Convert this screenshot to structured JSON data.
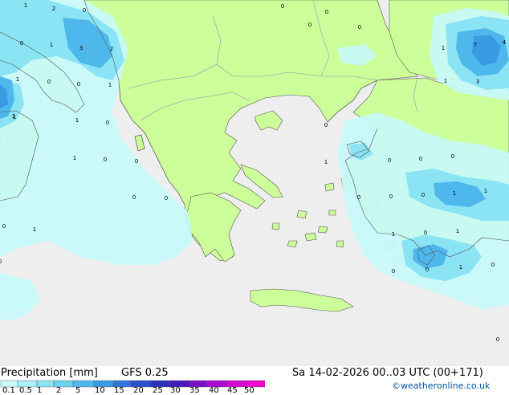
{
  "map": {
    "sea_color": "#eeeeee",
    "land_color": "#ccff99",
    "border_color": "#aaaaaa",
    "coast_color": "#555555",
    "value_labels": [
      "1",
      "2",
      "0",
      "0",
      "1",
      "3",
      "2",
      "1",
      "0",
      "0",
      "1",
      "1",
      "1",
      "0",
      "1",
      "0",
      "0",
      "0",
      "0",
      "1",
      "0",
      "0",
      "0",
      "1",
      "0",
      "1",
      "0",
      "0",
      "0",
      "1",
      "1",
      "0",
      "0",
      "0",
      "1",
      "0",
      "1",
      "0",
      "0",
      "1",
      "0",
      "0",
      "0",
      "0",
      "0",
      "1",
      "7",
      "4",
      "3",
      "1"
    ]
  },
  "legend": {
    "title": "Precipitation [mm]",
    "model": "GFS 0.25",
    "valid": "Sa 14-02-2026 00..03 UTC (00+171)",
    "credit": "©weatheronline.co.uk",
    "ticks": [
      "0.1",
      "0.5",
      "1",
      "2",
      "5",
      "10",
      "15",
      "20",
      "25",
      "30",
      "35",
      "40",
      "45",
      "50"
    ],
    "colors": [
      "#c8fafa",
      "#aaf0f8",
      "#8ae4f4",
      "#6cd4f0",
      "#4eb8ec",
      "#3a9ae4",
      "#3074dc",
      "#2850cc",
      "#2a30b8",
      "#4a18c0",
      "#7a10c8",
      "#a80cd0",
      "#d40ad4",
      "#f008cc"
    ]
  }
}
